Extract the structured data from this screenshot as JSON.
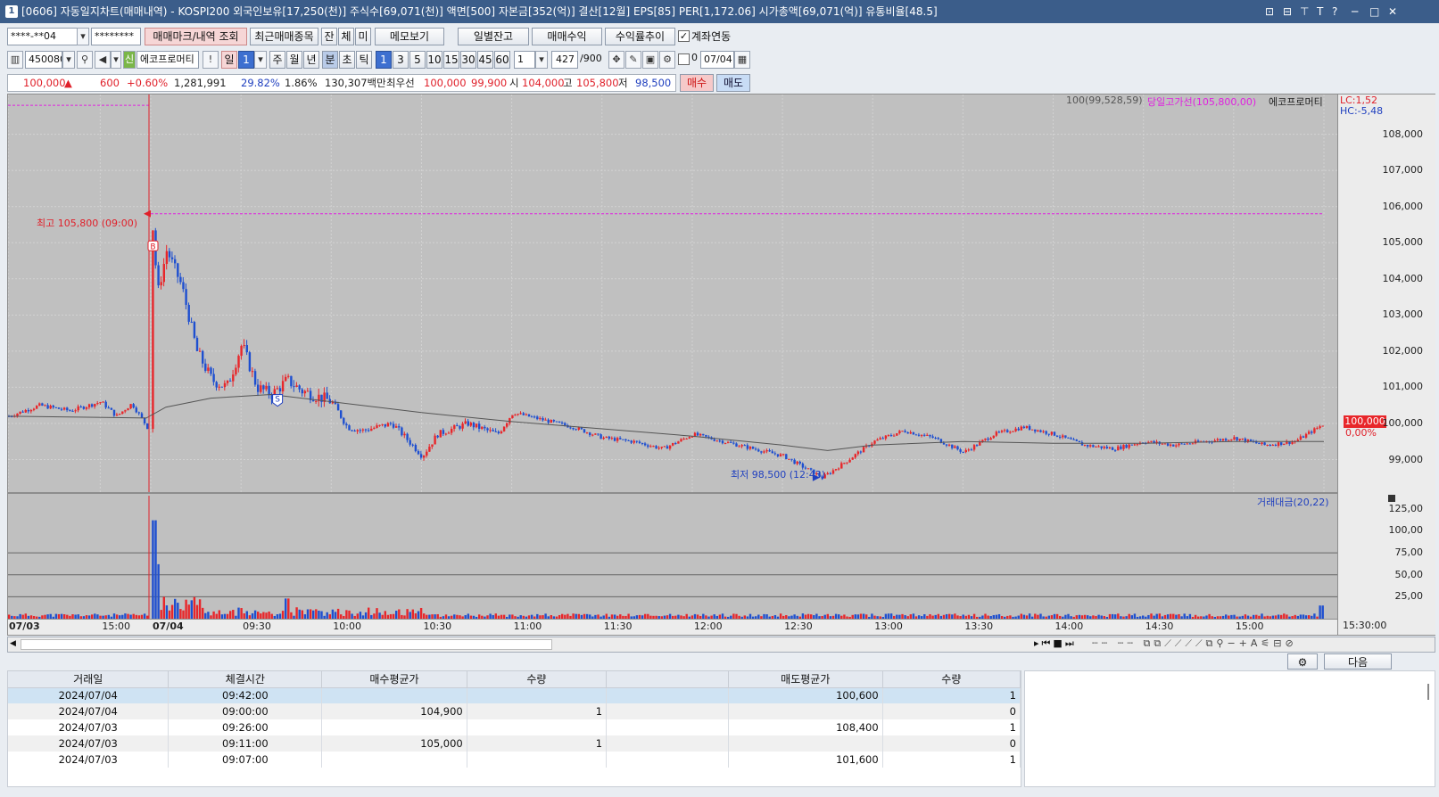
{
  "window": {
    "title": "[0606] 자동일지차트(매매내역) - KOSPI200 외국인보유[17,250(천)] 주식수[69,071(천)] 액면[500] 자본금[352(억)] 결산[12월] EPS[85] PER[1,172.06] 시가총액[69,071(억)] 유통비율[48.5]",
    "num": "1",
    "controls": [
      "⊡",
      "⊟",
      "⊤",
      "T",
      "?",
      "─",
      "□",
      "✕"
    ]
  },
  "toolbar1": {
    "account": "****-**04",
    "password": "********",
    "btn_trade_mark": "매매마크/내역 조회",
    "btn_recent": "최근매매종목",
    "btn_jan": "잔",
    "btn_che": "체",
    "btn_mi": "미",
    "btn_memo": "메모보기",
    "btn_daily": "일별잔고",
    "btn_profit": "매매수익",
    "btn_trend": "수익률추이",
    "check_link": "계좌연동"
  },
  "toolbar2": {
    "code": "450080",
    "stock_name": "에코프로머티",
    "period_day": "일",
    "period_val": "1",
    "periods": [
      "주",
      "월",
      "년",
      "분",
      "초",
      "틱"
    ],
    "minutes": [
      "1",
      "3",
      "5",
      "10",
      "15",
      "30",
      "45",
      "60"
    ],
    "interval": "1",
    "count": "427",
    "count_total": "/900",
    "date_checkbox": "0",
    "date": "07/04"
  },
  "quote": {
    "price": "100,000",
    "arrow": "▲",
    "change": "600",
    "change_pct": "+0.60%",
    "volume": "1,281,991",
    "turnover": "29.82%",
    "ratio": "1.86%",
    "amount": "130,307백만",
    "best_label": "최우선",
    "best_ask": "100,000",
    "best_bid": "99,900",
    "open_label": "시",
    "open": "104,000",
    "high_label": "고",
    "high": "105,800",
    "low_label": "저",
    "low": "98,500",
    "buy_btn": "매수",
    "sell_btn": "매도"
  },
  "chart_data": {
    "type": "candlestick",
    "legend_ma": "100(99,528,59)",
    "legend_high_line": "당일고가선(105,800,00)",
    "legend_stock": "에코프로머티",
    "lc": "LC:1,52",
    "hc": "HC:-5,48",
    "current_price": "100,000",
    "current_pct": "0,00%",
    "high_annotation": "최고 105,800 (09:00)",
    "low_annotation": "최저 98,500 (12:43)",
    "buy_mark": "B",
    "sell_mark": "S",
    "y_ticks": [
      "108,000",
      "107,000",
      "106,000",
      "105,000",
      "104,000",
      "103,000",
      "102,000",
      "101,000",
      "100,000",
      "99,000"
    ],
    "ylim": [
      98100,
      109100
    ],
    "volume_legend": "거래대금(20,22)",
    "volume_ticks": [
      "125,00",
      "100,00",
      "75,00",
      "50,00",
      "25,00"
    ],
    "x_labels": [
      "07/03",
      "15:00",
      "07/04",
      "09:30",
      "10:00",
      "10:30",
      "11:00",
      "11:30",
      "12:00",
      "12:30",
      "13:00",
      "13:30",
      "14:00",
      "14:30",
      "15:00",
      "15:30:00"
    ],
    "price_path": [
      [
        "07/03 14:00",
        100200
      ],
      [
        "07/03 14:20",
        100500
      ],
      [
        "07/03 14:40",
        100350
      ],
      [
        "07/03 15:00",
        100600
      ],
      [
        "07/03 15:10",
        100200
      ],
      [
        "07/03 15:20",
        100550
      ],
      [
        "07/03 15:30",
        99900
      ],
      [
        "09:00",
        105800
      ],
      [
        "09:02",
        103600
      ],
      [
        "09:05",
        104800
      ],
      [
        "09:10",
        103800
      ],
      [
        "09:15",
        102000
      ],
      [
        "09:20",
        101200
      ],
      [
        "09:25",
        101000
      ],
      [
        "09:30",
        102200
      ],
      [
        "09:35",
        101000
      ],
      [
        "09:40",
        100800
      ],
      [
        "09:45",
        101200
      ],
      [
        "09:50",
        100900
      ],
      [
        "10:00",
        100600
      ],
      [
        "10:05",
        99900
      ],
      [
        "10:10",
        99800
      ],
      [
        "10:20",
        100000
      ],
      [
        "10:30",
        99100
      ],
      [
        "10:35",
        99700
      ],
      [
        "10:45",
        100000
      ],
      [
        "10:55",
        99700
      ],
      [
        "11:00",
        100300
      ],
      [
        "11:10",
        100100
      ],
      [
        "11:20",
        99900
      ],
      [
        "11:30",
        99600
      ],
      [
        "11:40",
        99500
      ],
      [
        "11:50",
        99300
      ],
      [
        "12:00",
        99700
      ],
      [
        "12:10",
        99500
      ],
      [
        "12:20",
        99300
      ],
      [
        "12:30",
        99100
      ],
      [
        "12:43",
        98500
      ],
      [
        "12:50",
        98900
      ],
      [
        "13:00",
        99500
      ],
      [
        "13:10",
        99800
      ],
      [
        "13:20",
        99600
      ],
      [
        "13:30",
        99200
      ],
      [
        "13:40",
        99700
      ],
      [
        "13:50",
        99900
      ],
      [
        "14:00",
        99700
      ],
      [
        "14:10",
        99400
      ],
      [
        "14:20",
        99300
      ],
      [
        "14:30",
        99500
      ],
      [
        "14:40",
        99400
      ],
      [
        "14:50",
        99500
      ],
      [
        "15:00",
        99600
      ],
      [
        "15:10",
        99400
      ],
      [
        "15:20",
        99500
      ],
      [
        "15:30",
        100000
      ]
    ],
    "ma_path": [
      [
        "07/03 14:00",
        100200
      ],
      [
        "07/03 15:30",
        100150
      ],
      [
        "09:05",
        100450
      ],
      [
        "09:20",
        100700
      ],
      [
        "09:40",
        100800
      ],
      [
        "10:00",
        100600
      ],
      [
        "10:30",
        100300
      ],
      [
        "11:00",
        100050
      ],
      [
        "11:30",
        99850
      ],
      [
        "12:00",
        99650
      ],
      [
        "12:30",
        99400
      ],
      [
        "12:45",
        99250
      ],
      [
        "13:00",
        99400
      ],
      [
        "13:30",
        99500
      ],
      [
        "14:00",
        99450
      ],
      [
        "14:30",
        99450
      ],
      [
        "15:00",
        99500
      ],
      [
        "15:30",
        99500
      ]
    ]
  },
  "bottom": {
    "settings_btn": "⚙",
    "next_btn": "다음"
  },
  "trades": {
    "headers": [
      "거래일",
      "체결시간",
      "매수평균가",
      "수량",
      "",
      "매도평균가",
      "수량"
    ],
    "rows": [
      [
        "2024/07/04",
        "09:42:00",
        "",
        "",
        "",
        "100,600",
        "1"
      ],
      [
        "2024/07/04",
        "09:00:00",
        "104,900",
        "1",
        "",
        "",
        "0"
      ],
      [
        "2024/07/03",
        "09:26:00",
        "",
        "",
        "",
        "108,400",
        "1"
      ],
      [
        "2024/07/03",
        "09:11:00",
        "105,000",
        "1",
        "",
        "",
        "0"
      ],
      [
        "2024/07/03",
        "09:07:00",
        "",
        "",
        "",
        "101,600",
        "1"
      ]
    ]
  },
  "colors": {
    "up": "#e8262a",
    "down": "#1e4fd0",
    "ma": "#555555",
    "highline": "#e020e0",
    "title_bg": "#3b5d8a"
  }
}
